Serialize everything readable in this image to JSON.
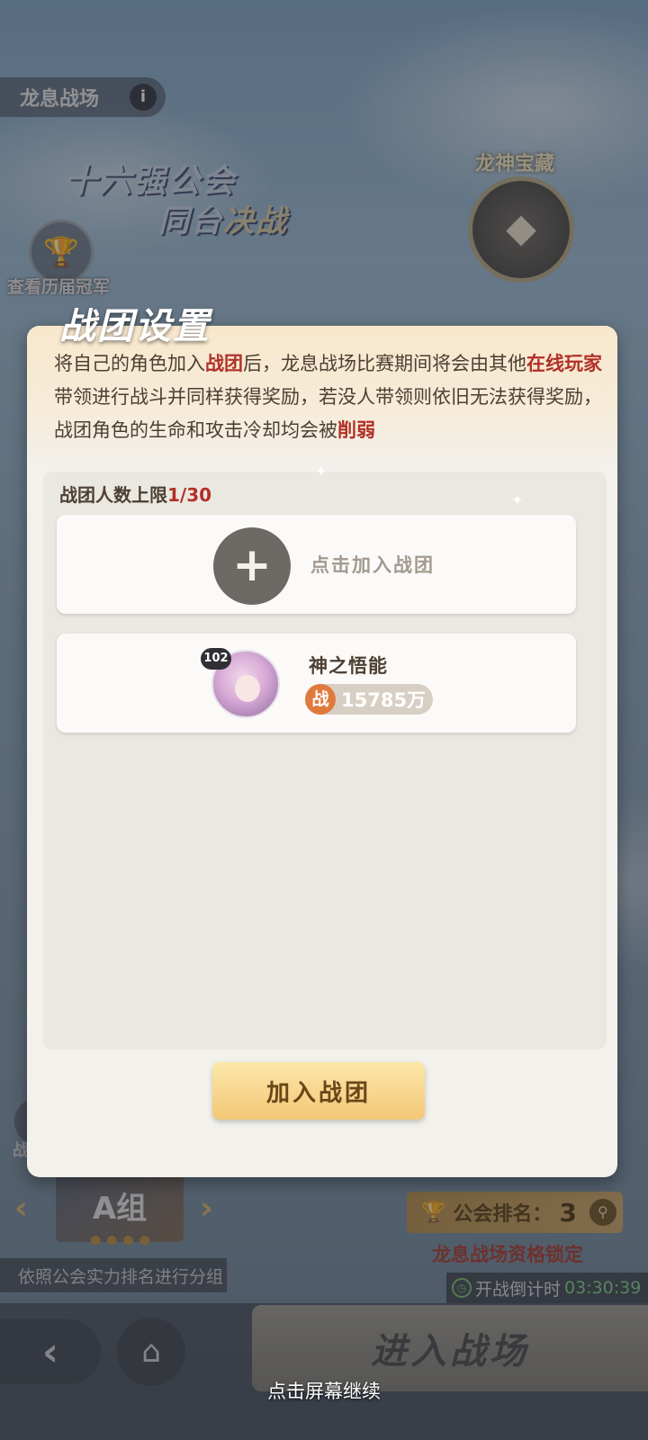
{
  "background": {
    "event_tag": "龙息战场",
    "info_icon": "i",
    "banner_line1": "十六强公会",
    "banner_line2_pre": "同台",
    "banner_line2_em": "决战",
    "history_label": "查看历届冠军",
    "treasure_title": "龙神宝藏",
    "side_label": "战团"
  },
  "modal": {
    "title": "战团设置",
    "desc_1": "将自己的角色加入",
    "desc_hl1": "战团",
    "desc_2": "后，龙息战场比赛期间将会由其他",
    "desc_hl2": "在线玩家",
    "desc_3": "带领进行战斗并同样获得奖励，若没人带领则依旧无法获得奖励，战团角色的生命和攻击冷却均会被",
    "desc_hl3": "削弱",
    "capacity_label": "战团人数上限",
    "capacity_value": "1/30",
    "add_slot_text": "点击加入战团",
    "member": {
      "level": "102",
      "name": "神之悟能",
      "power_badge": "战",
      "power_value": "15785万"
    },
    "join_button": "加入战团"
  },
  "bottom": {
    "group_label": "A组",
    "group_note": "依照公会实力排名进行分组",
    "rank_label": "公会排名：",
    "rank_value": "3",
    "qualification": "龙息战场资格锁定",
    "countdown_label": "开战倒计时",
    "countdown_time": "03:30:39",
    "enter_button": "进入战场",
    "continue_hint": "点击屏幕继续"
  }
}
